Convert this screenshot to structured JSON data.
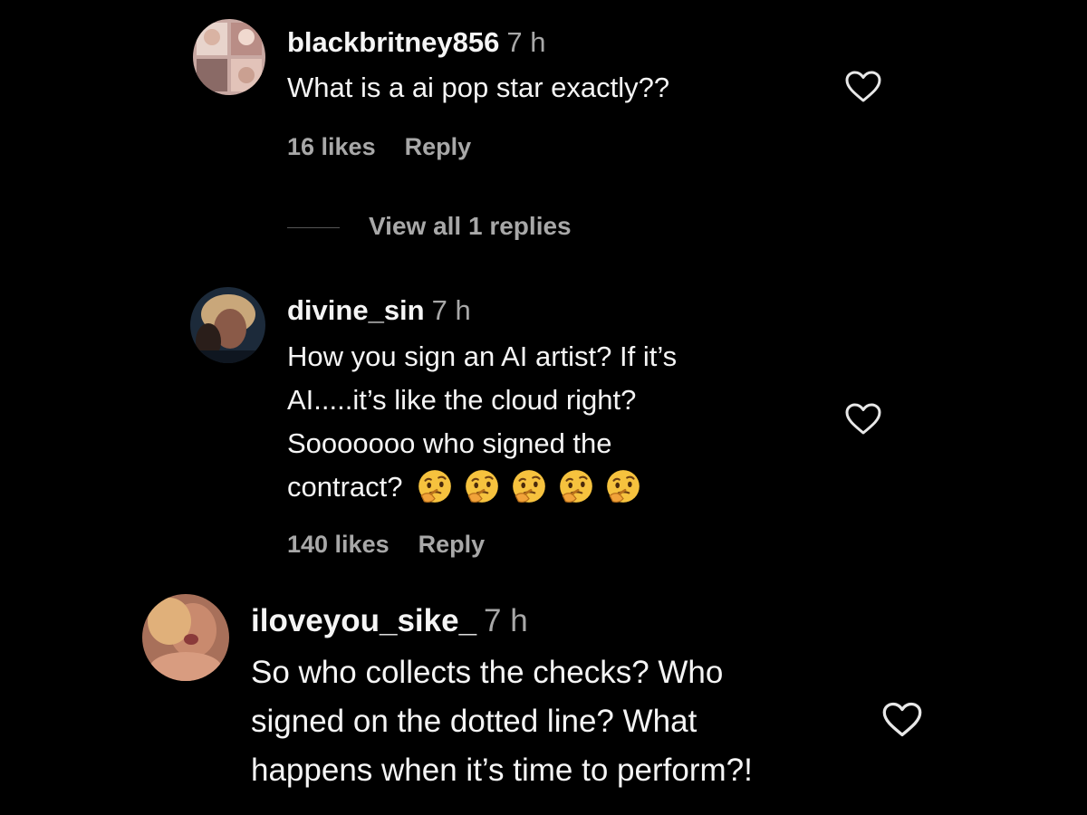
{
  "comments": [
    {
      "username": "blackbritney856",
      "time": "7 h",
      "text": "What is a ai pop star exactly??",
      "likes": "16 likes",
      "reply": "Reply",
      "view_replies": "View all 1 replies"
    },
    {
      "username": "divine_sin",
      "time": "7 h",
      "text_lines": [
        "How you sign an AI artist? If it’s",
        "AI.....it’s like the cloud right?",
        "Sooooooo who signed the",
        "contract?"
      ],
      "emoji": "thinking-face-emoji",
      "emoji_count": 5,
      "likes": "140 likes",
      "reply": "Reply"
    },
    {
      "username": "iloveyou_sike_",
      "time": "7 h",
      "text_lines": [
        "So who collects the checks? Who",
        "signed on the dotted line? What",
        "happens when it’s time to perform?!"
      ]
    }
  ],
  "icons": {
    "like": "heart-outline-icon"
  },
  "colors": {
    "background": "#000000",
    "primary_text": "#f5f5f5",
    "secondary_text": "#a8a8a8"
  }
}
